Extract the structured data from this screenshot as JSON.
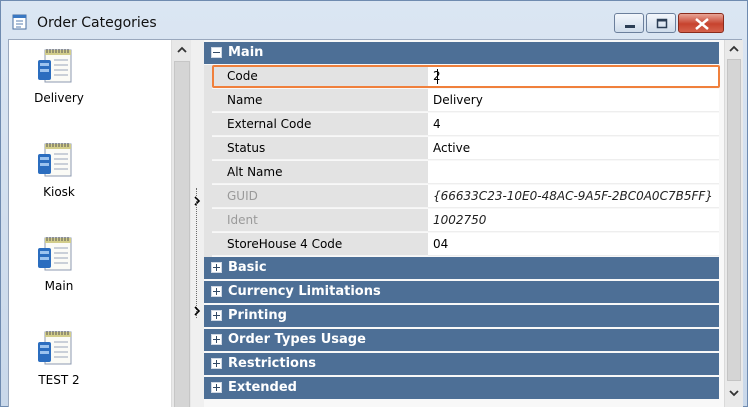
{
  "window": {
    "title": "Order Categories",
    "close_color": "#c7432e"
  },
  "categories": [
    {
      "label": "Delivery"
    },
    {
      "label": "Kiosk"
    },
    {
      "label": "Main"
    },
    {
      "label": "TEST 2"
    }
  ],
  "grid": {
    "main_group": {
      "label": "Main",
      "state": "expanded",
      "properties": [
        {
          "name": "Code",
          "value": "2",
          "readonly": false,
          "focused": true
        },
        {
          "name": "Name",
          "value": "Delivery",
          "readonly": false
        },
        {
          "name": "External Code",
          "value": "4",
          "readonly": false
        },
        {
          "name": "Status",
          "value": "Active",
          "readonly": false
        },
        {
          "name": "Alt Name",
          "value": "",
          "readonly": false
        },
        {
          "name": "GUID",
          "value": "{66633C23-10E0-48AC-9A5F-2BC0A0C7B5FF}",
          "readonly": true
        },
        {
          "name": "Ident",
          "value": "1002750",
          "readonly": true
        },
        {
          "name": "StoreHouse 4 Code",
          "value": "04",
          "readonly": false
        }
      ]
    },
    "collapsed_groups": [
      {
        "label": "Basic"
      },
      {
        "label": "Currency Limitations"
      },
      {
        "label": "Printing"
      },
      {
        "label": "Order Types Usage"
      },
      {
        "label": "Restrictions"
      },
      {
        "label": "Extended"
      }
    ]
  },
  "colors": {
    "group_header": "#4d6f96",
    "focus_border": "#f0803c"
  }
}
